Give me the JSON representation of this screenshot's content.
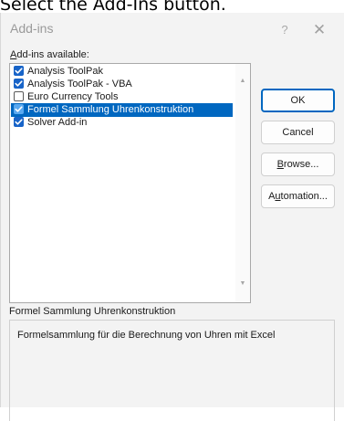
{
  "instruction": "Select the Add-Ins button.",
  "dialog": {
    "title": "Add-ins",
    "help_glyph": "?",
    "close_glyph": "✕"
  },
  "list": {
    "label_accel": "A",
    "label_rest": "dd-ins available:",
    "items": [
      {
        "label": "Analysis ToolPak",
        "checked": true,
        "selected": false
      },
      {
        "label": "Analysis ToolPak - VBA",
        "checked": true,
        "selected": false
      },
      {
        "label": "Euro Currency Tools",
        "checked": false,
        "selected": false
      },
      {
        "label": "Formel Sammlung Uhrenkonstruktion",
        "checked": true,
        "selected": true
      },
      {
        "label": "Solver Add-in",
        "checked": true,
        "selected": false
      }
    ]
  },
  "buttons": {
    "ok": "OK",
    "cancel": "Cancel",
    "browse_accel": "B",
    "browse_rest": "rowse...",
    "automation_pre": "A",
    "automation_accel": "u",
    "automation_rest": "tomation..."
  },
  "description": {
    "name": "Formel Sammlung Uhrenkonstruktion",
    "text": "Formelsammlung für die Berechnung von Uhren mit Excel"
  },
  "colors": {
    "accent": "#0067c0",
    "checkbox": "#1864c8"
  },
  "icons": {
    "scroll_up": "scroll-up-arrow-icon",
    "scroll_down": "scroll-down-arrow-icon",
    "check": "checkmark-icon"
  }
}
